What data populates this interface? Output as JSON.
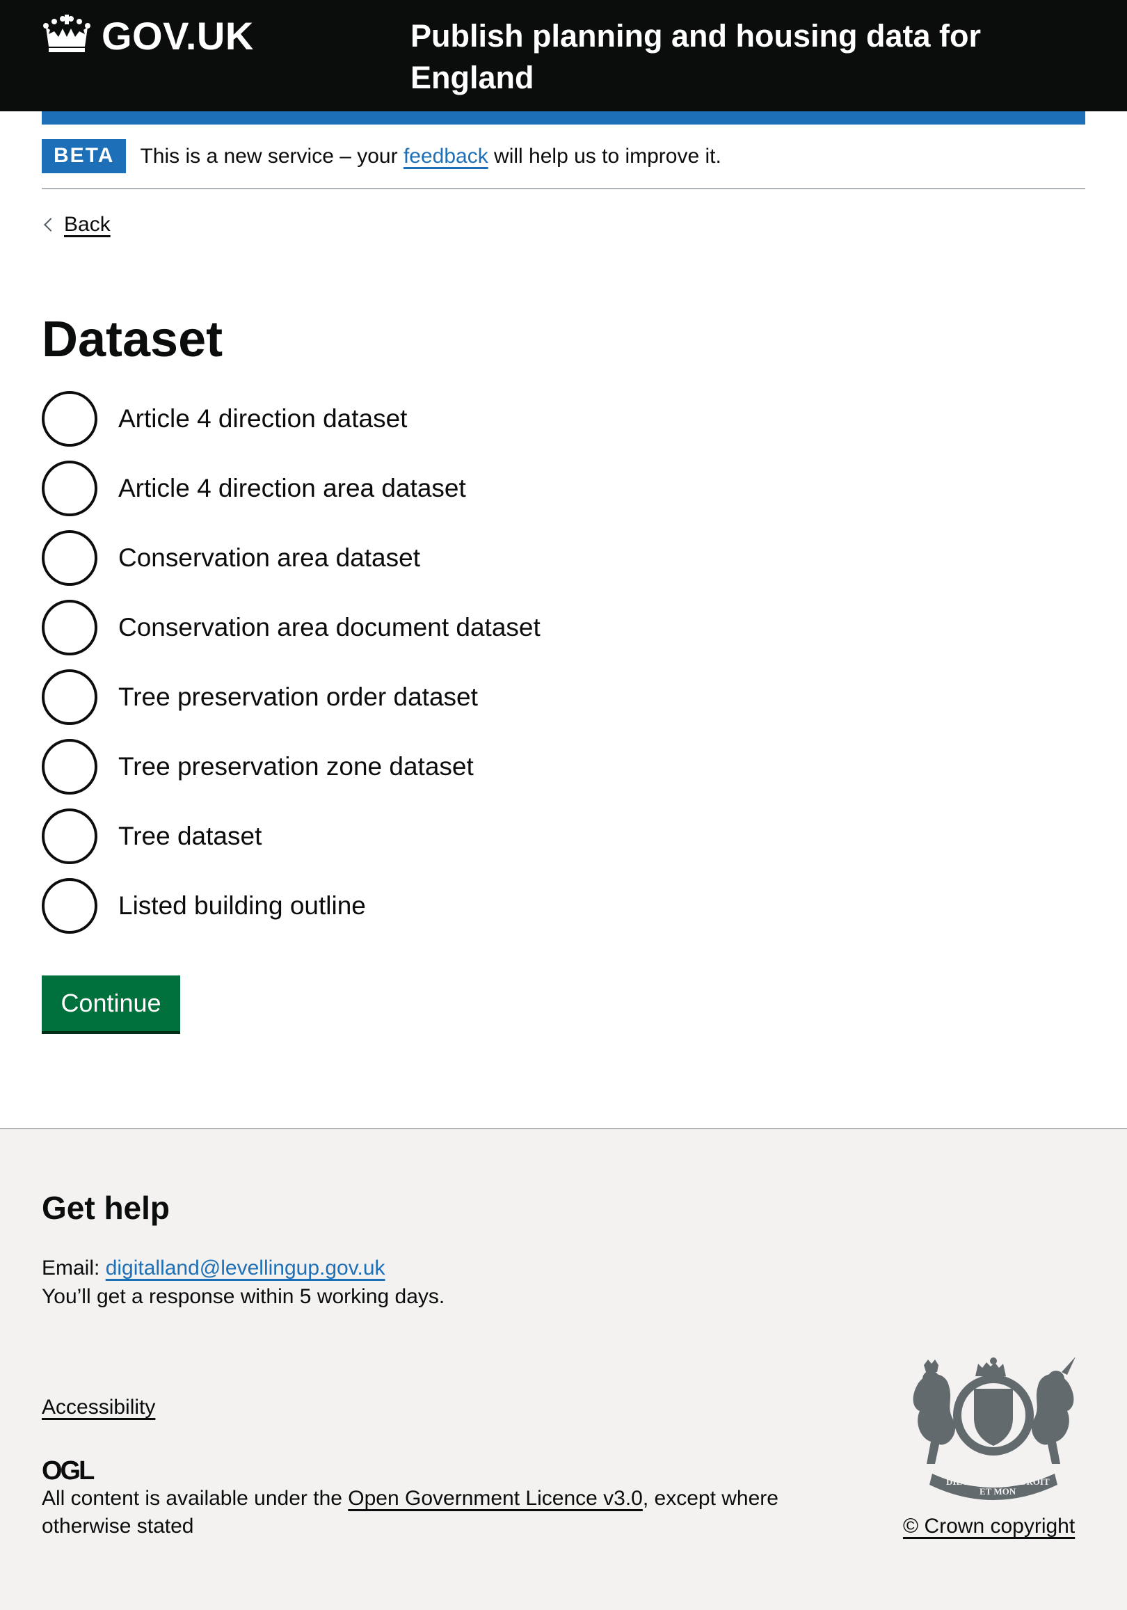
{
  "header": {
    "logo_text": "GOV.UK",
    "service_name": "Publish planning and housing data for England"
  },
  "phase_banner": {
    "tag": "BETA",
    "text_before": "This is a new service – your ",
    "link_text": "feedback",
    "text_after": " will help us to improve it."
  },
  "back_link": "Back",
  "page": {
    "title": "Dataset",
    "options": [
      {
        "label": "Article 4 direction dataset"
      },
      {
        "label": "Article 4 direction area dataset"
      },
      {
        "label": "Conservation area dataset"
      },
      {
        "label": "Conservation area document dataset"
      },
      {
        "label": "Tree preservation order dataset"
      },
      {
        "label": "Tree preservation zone dataset"
      },
      {
        "label": "Tree dataset"
      },
      {
        "label": "Listed building outline"
      }
    ],
    "continue_label": "Continue"
  },
  "footer": {
    "help_title": "Get help",
    "email_label": "Email: ",
    "email": "digitalland@levellingup.gov.uk",
    "response_text": "You’ll get a response within 5 working days.",
    "accessibility_link": "Accessibility",
    "ogl_text": "OGL",
    "licence_before": "All content is available under the ",
    "licence_link": "Open Government Licence v3.0",
    "licence_after": ", except where otherwise stated",
    "crest_motto_1": "DIEU",
    "crest_motto_2": "ET MON",
    "crest_motto_3": "DROIT",
    "copyright": "© Crown copyright"
  },
  "colors": {
    "header_bg": "#0b0c0c",
    "brand_blue": "#1d70b8",
    "button_green": "#00703c",
    "footer_bg": "#f3f2f1"
  }
}
